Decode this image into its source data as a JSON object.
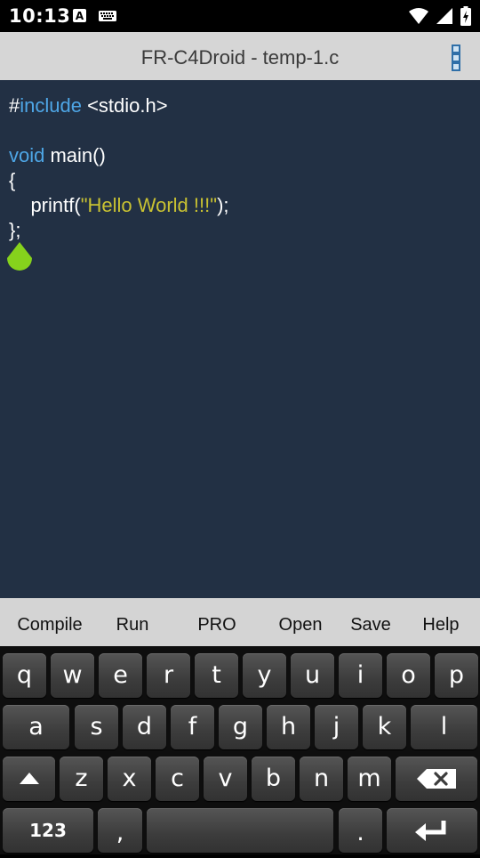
{
  "status_bar": {
    "time": "10:13",
    "icons": [
      "text-a-icon",
      "keyboard-icon",
      "wifi-icon",
      "signal-icon",
      "battery-charging-icon"
    ]
  },
  "title_bar": {
    "title": "FR-C4Droid - temp-1.c"
  },
  "editor": {
    "lines": {
      "l1_hash": "#",
      "l1_kw": "include",
      "l1_rest": " <stdio.h>",
      "l3_kw": "void",
      "l3_rest": " main()",
      "l4": "{",
      "l5_pre": "    printf(",
      "l5_str": "\"Hello World !!!\"",
      "l5_post": ");",
      "l6": "};"
    },
    "colors": {
      "background": "#223044",
      "keyword": "#4ea6e6",
      "string": "#c8c132",
      "text": "#ffffff",
      "cursor_handle": "#86d21c"
    }
  },
  "toolbar": {
    "compile": "Compile",
    "run": "Run",
    "pro": "PRO",
    "open": "Open",
    "save": "Save",
    "help": "Help"
  },
  "keyboard": {
    "row1": [
      "q",
      "w",
      "e",
      "r",
      "t",
      "y",
      "u",
      "i",
      "o",
      "p"
    ],
    "row2": [
      "a",
      "s",
      "d",
      "f",
      "g",
      "h",
      "j",
      "k",
      "l"
    ],
    "row3": [
      "z",
      "x",
      "c",
      "v",
      "b",
      "n",
      "m"
    ],
    "numbers_label": "123",
    "comma": ",",
    "period": "."
  }
}
